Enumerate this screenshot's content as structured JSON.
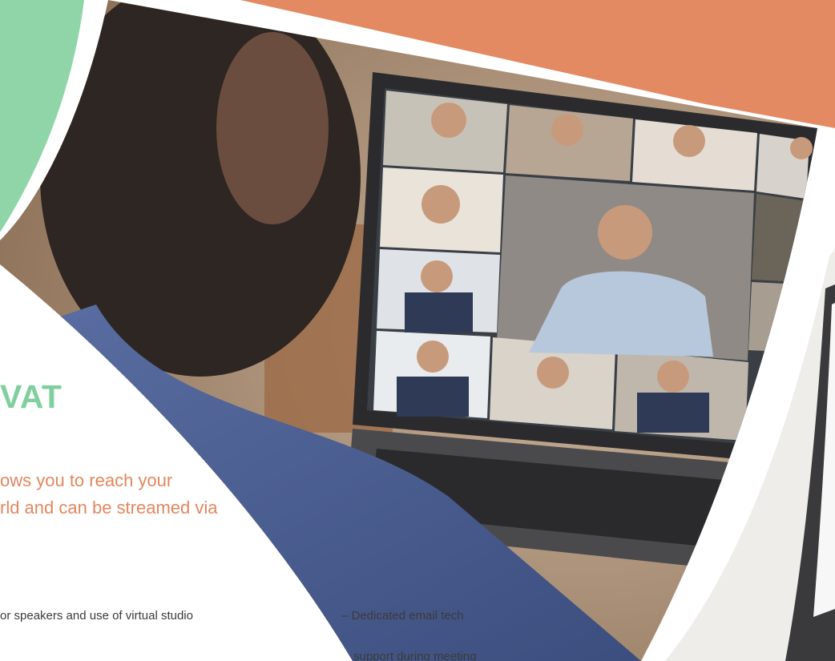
{
  "page": {
    "heading": "VAT",
    "intro": {
      "line1": "ows you to reach your",
      "line2": "rld and can be streamed via"
    },
    "bullets": {
      "left": "or speakers and use of virtual studio",
      "right_line1": "– Dedicated email tech",
      "right_line2": "support during meeting"
    }
  },
  "colors": {
    "accent_green": "#8fd5a8",
    "accent_orange": "#e38a62",
    "heading_green": "#7fcf9f",
    "intro_orange": "#e3865f",
    "body_text": "#3b3b3b"
  },
  "image": {
    "description_icon": "video-conference-photo"
  }
}
